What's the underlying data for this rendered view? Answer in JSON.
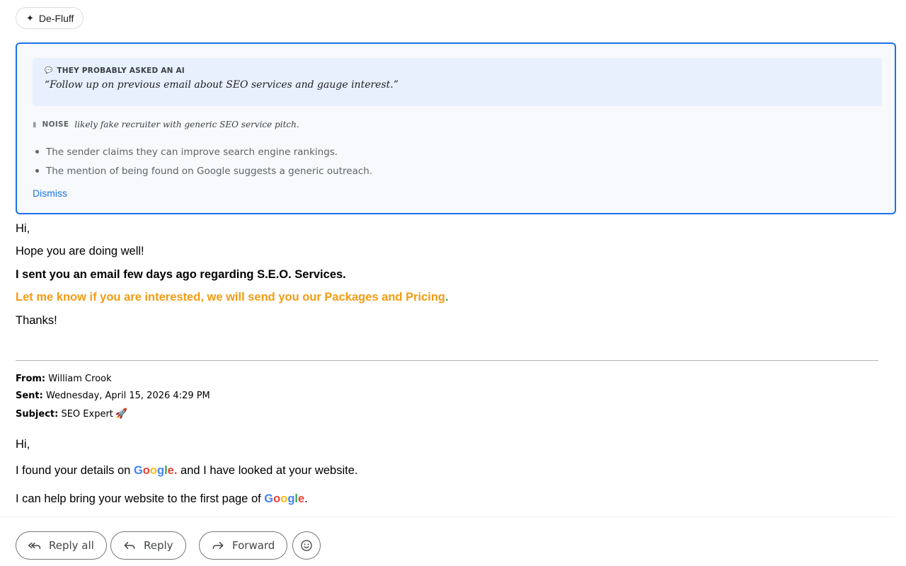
{
  "defluff": {
    "label": "De-Fluff",
    "icon": "sparkle-icon"
  },
  "analysis": {
    "ai_heading": "THEY PROBABLY ASKED AN AI",
    "ai_quote": "“Follow up on previous email about SEO services and gauge interest.”",
    "noise_label": "NOISE",
    "noise_text": "likely fake recruiter with generic SEO service pitch.",
    "bullets": [
      "The sender claims they can improve search engine rankings.",
      "The mention of being found on Google suggests a generic outreach."
    ],
    "dismiss": "Dismiss"
  },
  "email": {
    "greeting": "Hi,",
    "line1": "Hope you are doing well!",
    "line2": "I sent you an email few days ago regarding S.E.O. Services.",
    "line3": "Let me know if you are interested, we will send you our Packages and Pricing",
    "line3_end": ".",
    "thanks": "Thanks!"
  },
  "quoted": {
    "from_label": "From:",
    "from_value": "William Crook",
    "sent_label": "Sent:",
    "sent_value": "Wednesday, April 15, 2026 4:29 PM",
    "subject_label": "Subject:",
    "subject_value": "SEO Expert",
    "subject_emoji": "🚀",
    "greeting": "Hi,",
    "line1_a": "I found your details on",
    "line1_b": " and I have looked at your website.",
    "line2_a": "I can help bring your website to the first page of",
    "line2_b": ".",
    "google_dot": "."
  },
  "google_letters": [
    {
      "ch": "G",
      "color": "#4285f4"
    },
    {
      "ch": "o",
      "color": "#ea4335"
    },
    {
      "ch": "o",
      "color": "#fbbc05"
    },
    {
      "ch": "g",
      "color": "#4285f4"
    },
    {
      "ch": "l",
      "color": "#34a853"
    },
    {
      "ch": "e",
      "color": "#ea4335"
    }
  ],
  "actions": {
    "reply_all": "Reply all",
    "reply": "Reply",
    "forward": "Forward"
  }
}
